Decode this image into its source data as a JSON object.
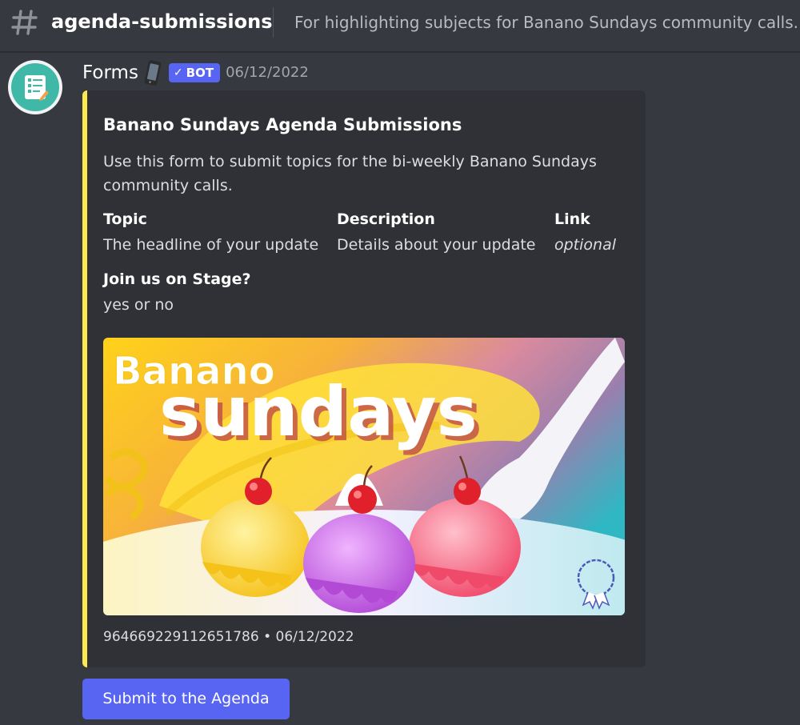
{
  "header": {
    "channel_name": "agenda-submissions",
    "channel_topic": "For highlighting subjects for Banano Sundays community calls."
  },
  "message": {
    "author": "Forms",
    "bot_tag": "BOT",
    "timestamp": "06/12/2022",
    "avatar_color": "#3fb8a8",
    "embed": {
      "accent_color": "#fde84e",
      "title": "Banano Sundays Agenda Submissions",
      "description": "Use this form to submit topics for the bi-weekly Banano Sundays community calls.",
      "fields": [
        {
          "name": "Topic",
          "value": "The headline of your update"
        },
        {
          "name": "Description",
          "value": "Details about your update"
        },
        {
          "name": "Link",
          "value": "optional"
        },
        {
          "name": "Join us on Stage?",
          "value": "yes or no"
        }
      ],
      "image": {
        "word1": "Banano",
        "word2": "sundays"
      },
      "footer": "964669229112651786 • 06/12/2022"
    },
    "button_label": "Submit to the Agenda"
  }
}
